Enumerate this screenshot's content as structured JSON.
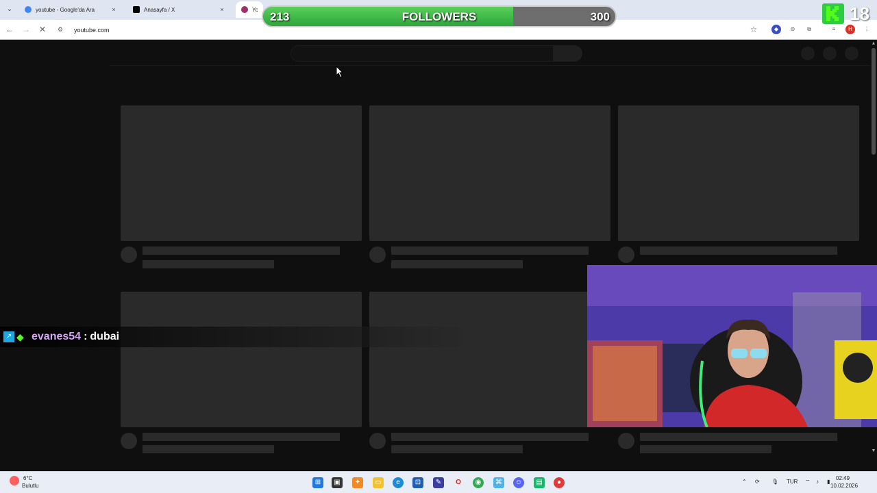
{
  "browser": {
    "tabs": [
      {
        "title": "youtube - Google'da Ara",
        "close": "×"
      },
      {
        "title": "Anasayfa / X",
        "close": "×"
      },
      {
        "title": "YouTube"
      }
    ],
    "url": "youtube.com",
    "tab_menu": "⌄"
  },
  "overlay": {
    "followers_current": "213",
    "followers_label": "FOLLOWERS",
    "followers_goal": "300",
    "followers_progress": 0.71,
    "age_rating": "18",
    "chat": {
      "user": "evanes54",
      "separator": ":",
      "message": "dubai"
    }
  },
  "taskbar": {
    "weather_temp": "6°C",
    "weather_desc": "Bulutlu",
    "language": "TUR",
    "time": "02:49",
    "date": "10.02.2026"
  },
  "colors": {
    "follow_fill": "#3fbf45",
    "chat_user": "#d6a5f7",
    "page_bg": "#0f0f0f",
    "skeleton": "#2a2a2a"
  }
}
